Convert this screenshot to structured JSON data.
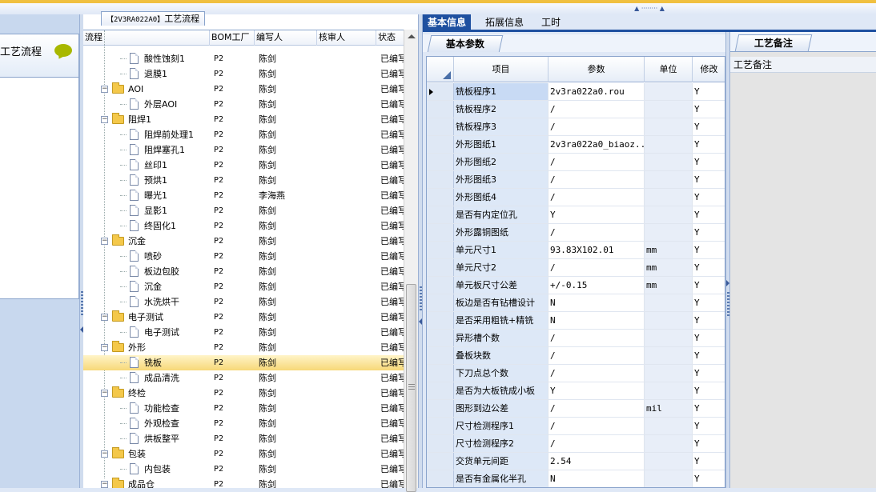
{
  "left_panel": {
    "title": "工艺流程"
  },
  "tree": {
    "title_code": "【2V3RA022A0】",
    "title_label": "工艺流程",
    "columns": [
      "流程",
      "BOM工厂",
      "编写人",
      "核审人",
      "状态"
    ],
    "rows": [
      {
        "name": "酸性蚀刻1",
        "level": 2,
        "type": "doc",
        "bom": "P2",
        "writer": "陈剑",
        "reviewer": "",
        "status": "已编写"
      },
      {
        "name": "退膜1",
        "level": 2,
        "type": "doc",
        "bom": "P2",
        "writer": "陈剑",
        "reviewer": "",
        "status": "已编写"
      },
      {
        "name": "AOI",
        "level": 1,
        "type": "folder",
        "bom": "P2",
        "writer": "陈剑",
        "reviewer": "",
        "status": "已编写"
      },
      {
        "name": "外层AOI",
        "level": 2,
        "type": "doc",
        "bom": "P2",
        "writer": "陈剑",
        "reviewer": "",
        "status": "已编写"
      },
      {
        "name": "阻焊1",
        "level": 1,
        "type": "folder",
        "bom": "P2",
        "writer": "陈剑",
        "reviewer": "",
        "status": "已编写"
      },
      {
        "name": "阻焊前处理1",
        "level": 2,
        "type": "doc",
        "bom": "P2",
        "writer": "陈剑",
        "reviewer": "",
        "status": "已编写"
      },
      {
        "name": "阻焊塞孔1",
        "level": 2,
        "type": "doc",
        "bom": "P2",
        "writer": "陈剑",
        "reviewer": "",
        "status": "已编写"
      },
      {
        "name": "丝印1",
        "level": 2,
        "type": "doc",
        "bom": "P2",
        "writer": "陈剑",
        "reviewer": "",
        "status": "已编写"
      },
      {
        "name": "预烘1",
        "level": 2,
        "type": "doc",
        "bom": "P2",
        "writer": "陈剑",
        "reviewer": "",
        "status": "已编写"
      },
      {
        "name": "曝光1",
        "level": 2,
        "type": "doc",
        "bom": "P2",
        "writer": "李海燕",
        "reviewer": "",
        "status": "已编写"
      },
      {
        "name": "显影1",
        "level": 2,
        "type": "doc",
        "bom": "P2",
        "writer": "陈剑",
        "reviewer": "",
        "status": "已编写"
      },
      {
        "name": "终固化1",
        "level": 2,
        "type": "doc",
        "bom": "P2",
        "writer": "陈剑",
        "reviewer": "",
        "status": "已编写"
      },
      {
        "name": "沉金",
        "level": 1,
        "type": "folder",
        "bom": "P2",
        "writer": "陈剑",
        "reviewer": "",
        "status": "已编写"
      },
      {
        "name": "喷砂",
        "level": 2,
        "type": "doc",
        "bom": "P2",
        "writer": "陈剑",
        "reviewer": "",
        "status": "已编写"
      },
      {
        "name": "板边包胶",
        "level": 2,
        "type": "doc",
        "bom": "P2",
        "writer": "陈剑",
        "reviewer": "",
        "status": "已编写"
      },
      {
        "name": "沉金",
        "level": 2,
        "type": "doc",
        "bom": "P2",
        "writer": "陈剑",
        "reviewer": "",
        "status": "已编写"
      },
      {
        "name": "水洗烘干",
        "level": 2,
        "type": "doc",
        "bom": "P2",
        "writer": "陈剑",
        "reviewer": "",
        "status": "已编写"
      },
      {
        "name": "电子测试",
        "level": 1,
        "type": "folder",
        "bom": "P2",
        "writer": "陈剑",
        "reviewer": "",
        "status": "已编写"
      },
      {
        "name": "电子测试",
        "level": 2,
        "type": "doc",
        "bom": "P2",
        "writer": "陈剑",
        "reviewer": "",
        "status": "已编写"
      },
      {
        "name": "外形",
        "level": 1,
        "type": "folder",
        "bom": "P2",
        "writer": "陈剑",
        "reviewer": "",
        "status": "已编写"
      },
      {
        "name": "铣板",
        "level": 2,
        "type": "doc",
        "bom": "P2",
        "writer": "陈剑",
        "reviewer": "",
        "status": "已编写",
        "selected": true
      },
      {
        "name": "成品清洗",
        "level": 2,
        "type": "doc",
        "bom": "P2",
        "writer": "陈剑",
        "reviewer": "",
        "status": "已编写"
      },
      {
        "name": "终检",
        "level": 1,
        "type": "folder",
        "bom": "P2",
        "writer": "陈剑",
        "reviewer": "",
        "status": "已编写"
      },
      {
        "name": "功能检查",
        "level": 2,
        "type": "doc",
        "bom": "P2",
        "writer": "陈剑",
        "reviewer": "",
        "status": "已编写"
      },
      {
        "name": "外观检查",
        "level": 2,
        "type": "doc",
        "bom": "P2",
        "writer": "陈剑",
        "reviewer": "",
        "status": "已编写"
      },
      {
        "name": "烘板整平",
        "level": 2,
        "type": "doc",
        "bom": "P2",
        "writer": "陈剑",
        "reviewer": "",
        "status": "已编写"
      },
      {
        "name": "包装",
        "level": 1,
        "type": "folder",
        "bom": "P2",
        "writer": "陈剑",
        "reviewer": "",
        "status": "已编写"
      },
      {
        "name": "内包装",
        "level": 2,
        "type": "doc",
        "bom": "P2",
        "writer": "陈剑",
        "reviewer": "",
        "status": "已编写"
      },
      {
        "name": "成品仓",
        "level": 1,
        "type": "folder",
        "bom": "P2",
        "writer": "陈剑",
        "reviewer": "",
        "status": "已编写"
      }
    ]
  },
  "tabs": [
    {
      "label": "基本信息",
      "active": true
    },
    {
      "label": "拓展信息",
      "active": false
    },
    {
      "label": "工时",
      "active": false
    }
  ],
  "params": {
    "subtab": "基本参数",
    "columns": [
      "项目",
      "参数",
      "单位",
      "修改"
    ],
    "rows": [
      {
        "name": "铣板程序1",
        "value": "2v3ra022a0.rou",
        "unit": "",
        "flag": "Y",
        "current": true
      },
      {
        "name": "铣板程序2",
        "value": "/",
        "unit": "",
        "flag": "Y"
      },
      {
        "name": "铣板程序3",
        "value": "/",
        "unit": "",
        "flag": "Y"
      },
      {
        "name": "外形图纸1",
        "value": "2v3ra022a0_biaoz...",
        "unit": "",
        "flag": "Y"
      },
      {
        "name": "外形图纸2",
        "value": "/",
        "unit": "",
        "flag": "Y"
      },
      {
        "name": "外形图纸3",
        "value": "/",
        "unit": "",
        "flag": "Y"
      },
      {
        "name": "外形图纸4",
        "value": "/",
        "unit": "",
        "flag": "Y"
      },
      {
        "name": "是否有内定位孔",
        "value": "Y",
        "unit": "",
        "flag": "Y"
      },
      {
        "name": "外形露铜图纸",
        "value": "/",
        "unit": "",
        "flag": "Y"
      },
      {
        "name": "单元尺寸1",
        "value": "93.83X102.01",
        "unit": "mm",
        "flag": "Y"
      },
      {
        "name": "单元尺寸2",
        "value": "/",
        "unit": "mm",
        "flag": "Y"
      },
      {
        "name": "单元板尺寸公差",
        "value": "+/-0.15",
        "unit": "mm",
        "flag": "Y"
      },
      {
        "name": "板边是否有钻槽设计",
        "value": "N",
        "unit": "",
        "flag": "Y"
      },
      {
        "name": "是否采用粗铣+精铣",
        "value": "N",
        "unit": "",
        "flag": "Y"
      },
      {
        "name": "异形槽个数",
        "value": "/",
        "unit": "",
        "flag": "Y"
      },
      {
        "name": "叠板块数",
        "value": "/",
        "unit": "",
        "flag": "Y"
      },
      {
        "name": "下刀点总个数",
        "value": "/",
        "unit": "",
        "flag": "Y"
      },
      {
        "name": "是否为大板铣成小板",
        "value": "Y",
        "unit": "",
        "flag": "Y"
      },
      {
        "name": "图形到边公差",
        "value": "/",
        "unit": "mil",
        "flag": "Y"
      },
      {
        "name": "尺寸检测程序1",
        "value": "/",
        "unit": "",
        "flag": "Y"
      },
      {
        "name": "尺寸检测程序2",
        "value": "/",
        "unit": "",
        "flag": "Y"
      },
      {
        "name": "交货单元间距",
        "value": "2.54",
        "unit": "",
        "flag": "Y"
      },
      {
        "name": "是否有金属化半孔",
        "value": "N",
        "unit": "",
        "flag": "Y"
      }
    ]
  },
  "notes": {
    "tab": "工艺备注",
    "header": "工艺备注"
  }
}
